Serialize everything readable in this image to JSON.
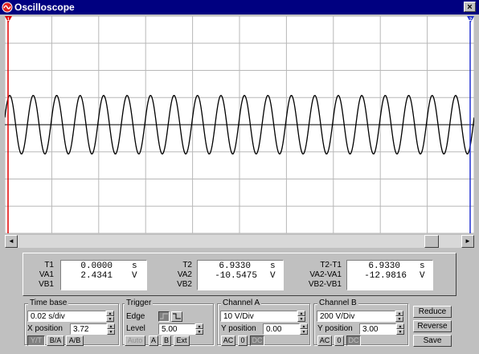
{
  "window": {
    "title": "Oscilloscope",
    "close_glyph": "×"
  },
  "cursors": {
    "t1_marker": "1",
    "t2_marker": "2",
    "t1_color": "#e00000",
    "t2_color": "#2030d0"
  },
  "trace": {
    "color": "#000000",
    "cycles_on_screen": 20,
    "amplitude_divisions": 1.08
  },
  "scrollbar": {
    "left_glyph": "◄",
    "right_glyph": "►"
  },
  "readouts": {
    "t1": {
      "labels": [
        "T1",
        "VA1",
        "VB1"
      ],
      "time": "0.0000",
      "time_unit": "s",
      "va": "2.4341",
      "va_unit": "V"
    },
    "t2": {
      "labels": [
        "T2",
        "VA2",
        "VB2"
      ],
      "time": "6.9330",
      "time_unit": "s",
      "va": "-10.5475",
      "va_unit": "V"
    },
    "diff": {
      "labels": [
        "T2-T1",
        "VA2-VA1",
        "VB2-VB1"
      ],
      "time": "6.9330",
      "time_unit": "s",
      "va": "-12.9816",
      "va_unit": "V"
    }
  },
  "timebase": {
    "title": "Time base",
    "scale": "0.02 s/div",
    "x_position_label": "X position",
    "x_position": "3.72",
    "modes": [
      "Y/T",
      "B/A",
      "A/B"
    ]
  },
  "trigger": {
    "title": "Trigger",
    "edge_label": "Edge",
    "level_label": "Level",
    "level": "5.00",
    "sources": [
      "Auto",
      "A",
      "B",
      "Ext"
    ]
  },
  "channel_a": {
    "title": "Channel A",
    "scale": "10  V/Div",
    "y_position_label": "Y position",
    "y_position": "0.00",
    "coupling": [
      "AC",
      "0",
      "DC"
    ]
  },
  "channel_b": {
    "title": "Channel B",
    "scale": "200  V/Div",
    "y_position_label": "Y position",
    "y_position": "3.00",
    "coupling": [
      "AC",
      "0",
      "DC"
    ]
  },
  "actions": {
    "reduce": "Reduce",
    "reverse": "Reverse",
    "save": "Save"
  }
}
